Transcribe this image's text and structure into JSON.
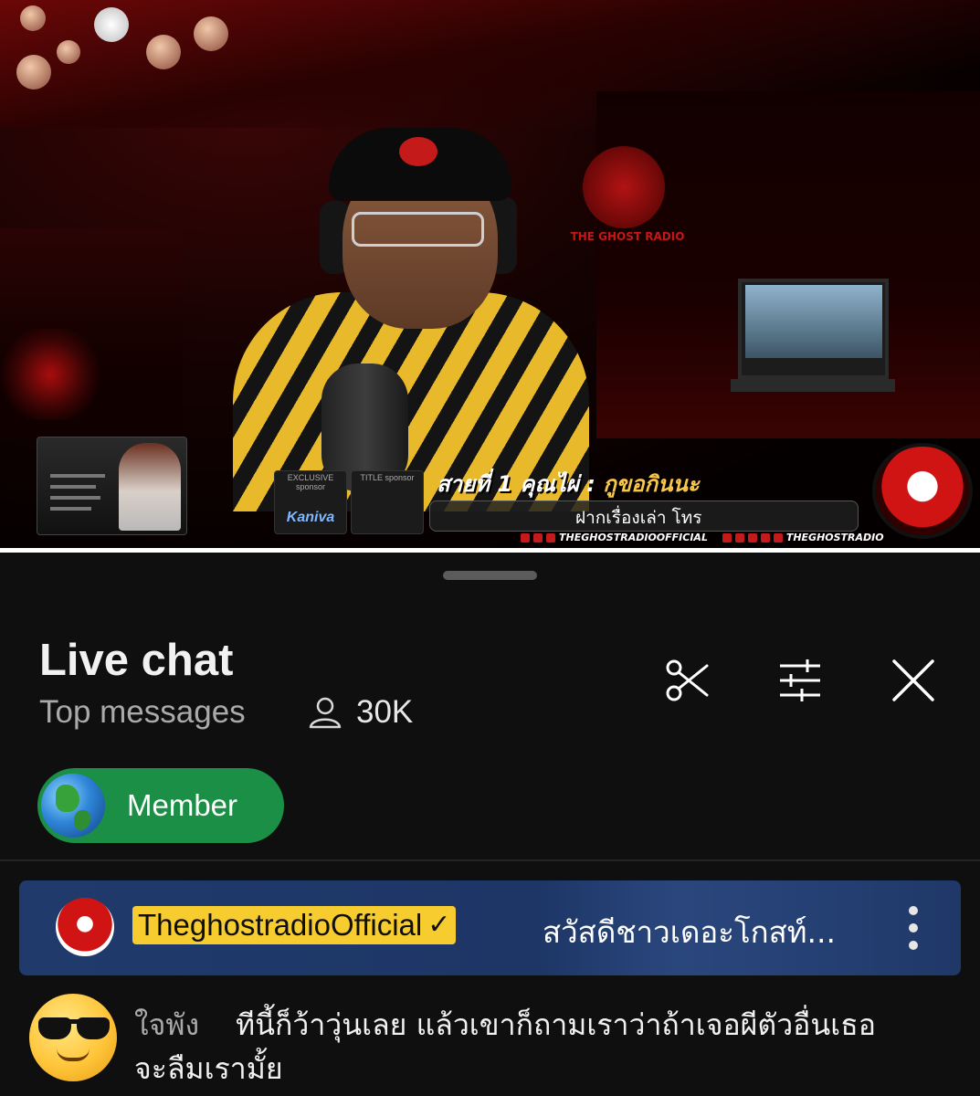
{
  "video": {
    "overlay_title_prefix": "สายที่ 1 คุณไผ่ :",
    "overlay_title_highlight": "กูขอกินนะ",
    "overlay_subtitle": "ฝากเรื่องเล่า โทร",
    "wall_logo_text": "THE GHOST RADIO",
    "sponsor_exclusive_label": "EXCLUSIVE sponsor",
    "sponsor_title_label": "TITLE sponsor",
    "sponsor_brand": "Kaniva",
    "social_left": "THEGHOSTRADIOOFFICIAL",
    "social_right": "THEGHOSTRADIO"
  },
  "chat": {
    "title": "Live chat",
    "mode": "Top messages",
    "viewer_count": "30K",
    "viewer_icon": "person-icon",
    "actions": [
      "scissors-icon",
      "filter-sliders-icon",
      "close-icon"
    ],
    "chip": {
      "label": "Member",
      "icon": "globe-icon",
      "color": "#1a8f45"
    },
    "pinned": {
      "author": "TheghostradioOfficial",
      "verified_icon": "check-icon",
      "message": "สวัสดีชาวเดอะโกสท์...",
      "menu_icon": "more-vertical-icon",
      "highlight_color": "#f7cc2e",
      "background_color": "#1f3868"
    },
    "messages": [
      {
        "author": "ใจพัง",
        "avatar_icon": "sunglasses-emoji-icon",
        "text_line1": "ทีนี้ก็ว้าวุ่นเลย แล้วเขาก็ถามเราว่าถ้าเจอผีตัวอื่นเธอ",
        "text_line2": "จะลืมเรามั้ย"
      }
    ]
  }
}
